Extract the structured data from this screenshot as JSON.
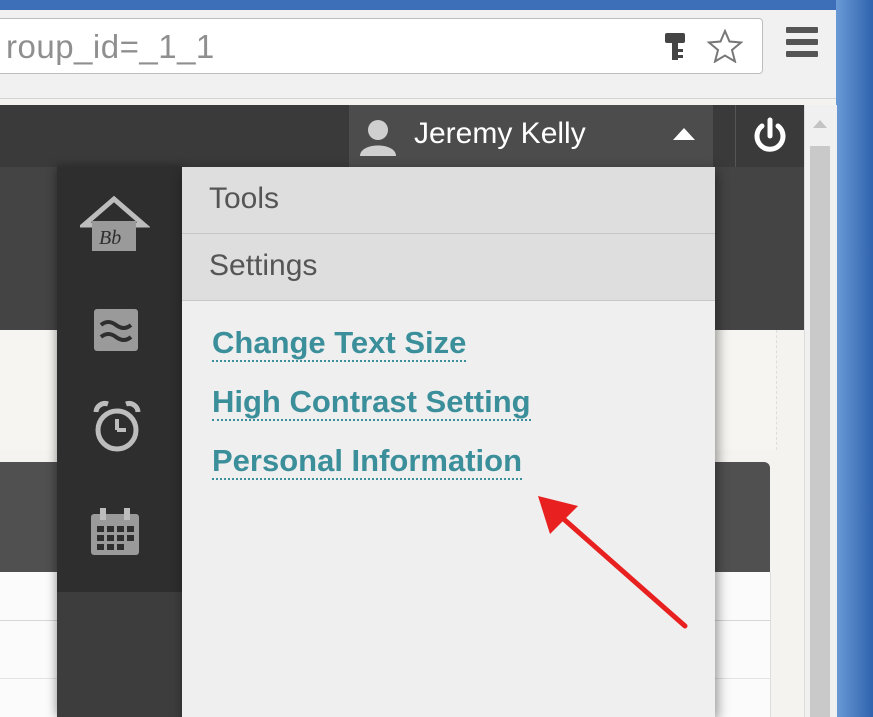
{
  "browser": {
    "address_text": "roup_id=_1_1",
    "key_icon": "key-icon",
    "star_icon": "bookmark-star-icon",
    "menu_icon": "hamburger-menu-icon"
  },
  "header": {
    "user_name": "Jeremy Kelly",
    "avatar_icon": "user-avatar-icon",
    "caret_icon": "caret-up-icon",
    "power_icon": "power-icon"
  },
  "sidenav": {
    "items": [
      {
        "icon": "blackboard-home-icon"
      },
      {
        "icon": "activity-stream-icon"
      },
      {
        "icon": "alarm-clock-icon"
      },
      {
        "icon": "calendar-icon"
      }
    ]
  },
  "menu": {
    "sections": [
      {
        "label": "Tools"
      },
      {
        "label": "Settings"
      }
    ],
    "links": [
      {
        "label": "Change Text Size"
      },
      {
        "label": "High Contrast Setting"
      },
      {
        "label": "Personal Information"
      }
    ]
  },
  "annotation": {
    "arrow_color": "#e8201f"
  },
  "colors": {
    "link": "#3b8f9b",
    "topbar": "#3a3a3a",
    "sidenav": "#2e2e2e"
  }
}
